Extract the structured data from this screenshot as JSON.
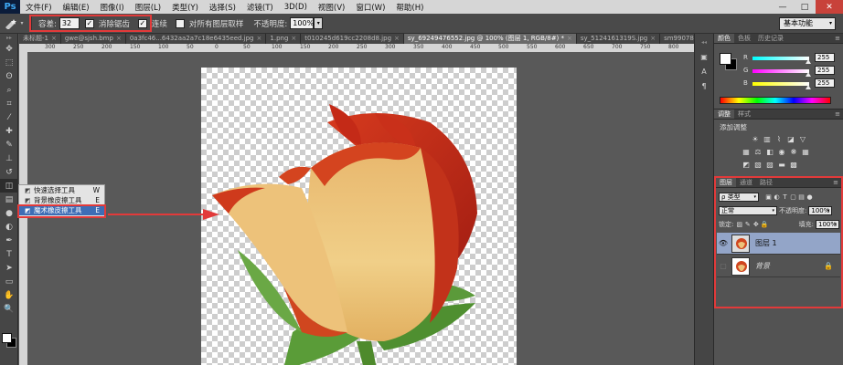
{
  "app": {
    "logo": "Ps"
  },
  "menu": [
    "文件(F)",
    "编辑(E)",
    "图像(I)",
    "图层(L)",
    "类型(Y)",
    "选择(S)",
    "滤镜(T)",
    "3D(D)",
    "视图(V)",
    "窗口(W)",
    "帮助(H)"
  ],
  "window_buttons": {
    "minimize": "—",
    "maximize": "□",
    "close": "✕"
  },
  "options": {
    "tolerance_label": "容差:",
    "tolerance_value": "32",
    "antialias_label": "消除锯齿",
    "contiguous_label": "连续",
    "sample_all_label": "对所有图层取样",
    "opacity_label": "不透明度:",
    "opacity_value": "100%",
    "workspace": "基本功能"
  },
  "tabs": [
    {
      "label": "未标题-1",
      "active": false
    },
    {
      "label": "gwe@sjsh.bmp",
      "active": false
    },
    {
      "label": "0a3fc46...6432aa2a7c18e6435eed.jpg",
      "active": false
    },
    {
      "label": "1.png",
      "active": false
    },
    {
      "label": "t010245d619cc2208d8.jpg",
      "active": false
    },
    {
      "label": "sy_69249476552.jpg @ 100% (图层 1, RGB/8#) *",
      "active": true
    },
    {
      "label": "sy_5124161319S.jpg",
      "active": false
    },
    {
      "label": "sm99078106.jpg",
      "active": false
    }
  ],
  "ruler": [
    "300",
    "250",
    "200",
    "150",
    "100",
    "50",
    "0",
    "50",
    "100",
    "150",
    "200",
    "250",
    "300",
    "350",
    "400",
    "450",
    "500",
    "550",
    "600",
    "650",
    "700",
    "750",
    "800",
    "850"
  ],
  "flyout": [
    {
      "label": "快速选择工具",
      "key": "W",
      "selected": false
    },
    {
      "label": "背景橡皮擦工具",
      "key": "E",
      "selected": false
    },
    {
      "label": "魔术橡皮擦工具",
      "key": "E",
      "selected": true
    }
  ],
  "color_panel": {
    "tabs": [
      "颜色",
      "色板",
      "历史记录"
    ],
    "channels": [
      {
        "label": "R",
        "value": "255",
        "color": "#00ffff"
      },
      {
        "label": "G",
        "value": "255",
        "color": "#ff00ff"
      },
      {
        "label": "B",
        "value": "255",
        "color": "#ffff00"
      }
    ]
  },
  "adjust_panel": {
    "tabs": [
      "调整",
      "样式"
    ],
    "title": "添加调整"
  },
  "layers_panel": {
    "tabs": [
      "图层",
      "通道",
      "路径"
    ],
    "filter": "类型",
    "blend_mode": "正常",
    "opacity_label": "不透明度:",
    "opacity_value": "100%",
    "lock_label": "锁定:",
    "fill_label": "填充:",
    "fill_value": "100%",
    "layers": [
      {
        "name": "图层 1",
        "selected": true
      },
      {
        "name": "背景",
        "selected": false
      }
    ]
  },
  "colors": {
    "highlight": "#e23a3a",
    "selection": "#93a5c8",
    "canvas_bg": "#595959"
  }
}
